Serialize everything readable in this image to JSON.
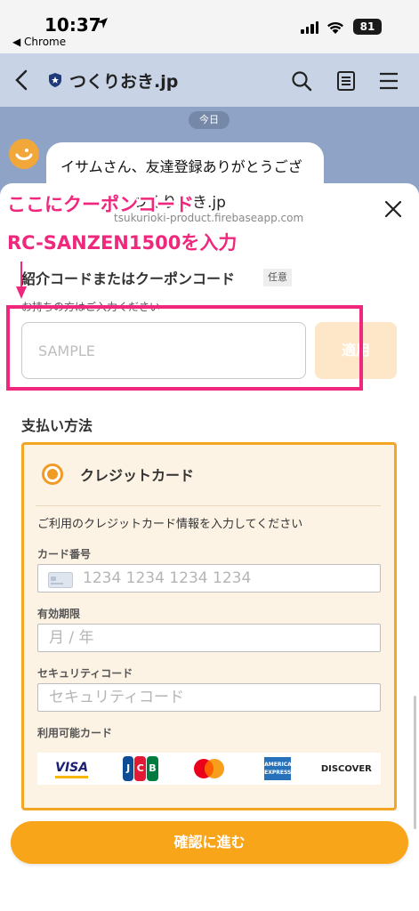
{
  "status_bar": {
    "time": "10:37",
    "back_app": "◀ Chrome",
    "battery": "81"
  },
  "line_header": {
    "title": "つくりおき.jp"
  },
  "chat": {
    "date": "今日",
    "message": "イサムさん、友達登録ありがとうございます🙂✨"
  },
  "sheet": {
    "title": "つくりおき.jp",
    "url": "tsukurioki-product.firebaseapp.com"
  },
  "annotation": {
    "line1": "ここにクーポンコード",
    "line2": "RC-SANZEN1500を入力",
    "color": "#f0287d"
  },
  "coupon": {
    "label": "紹介コードまたはクーポンコード",
    "optional_badge": "任意",
    "help": "お持ちの方はご入力ください",
    "placeholder": "SAMPLE",
    "value": "",
    "apply_label": "適用"
  },
  "payment": {
    "section_title": "支払い方法",
    "method_label": "クレジットカード",
    "method_selected": true,
    "help": "ご利用のクレジットカード情報を入力してください",
    "card_number_label": "カード番号",
    "card_number_placeholder": "1234 1234 1234 1234",
    "expiry_label": "有効期限",
    "expiry_placeholder": "月 / 年",
    "cvc_label": "セキュリティコード",
    "cvc_placeholder": "セキュリティコード",
    "brands_label": "利用可能カード",
    "brands": [
      "VISA",
      "JCB",
      "mastercard",
      "AMERICAN EXPRESS",
      "DISCOVER"
    ]
  },
  "confirm_button": "確認に進む",
  "colors": {
    "accent": "#f9a51a",
    "annotation": "#f0287d",
    "header": "#c8d3e6",
    "chat_bg": "#8fa3c6"
  }
}
